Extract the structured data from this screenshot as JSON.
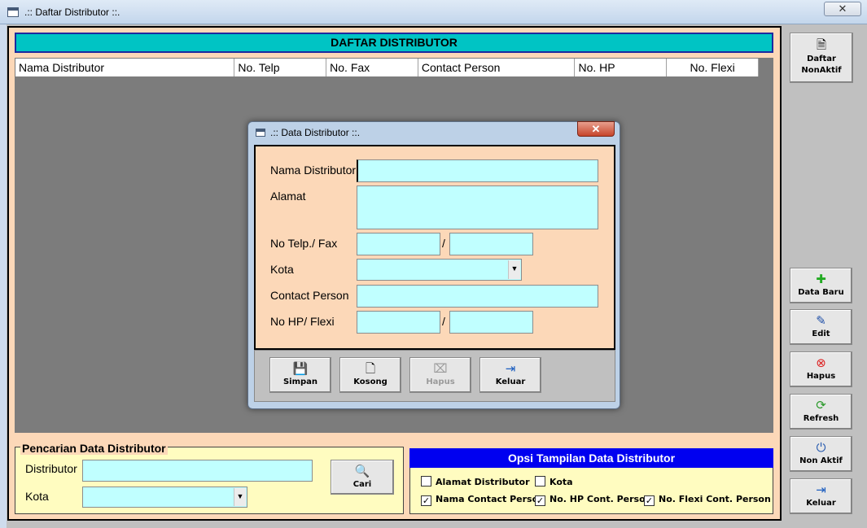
{
  "window": {
    "title": ".:: Daftar Distributor ::.",
    "close_glyph": "✕"
  },
  "list": {
    "title": "DAFTAR DISTRIBUTOR",
    "columns": [
      "Nama Distributor",
      "No. Telp",
      "No. Fax",
      "Contact Person",
      "No. HP",
      "No. Flexi"
    ]
  },
  "search": {
    "legend": "Pencarian Data Distributor",
    "distributor_label": "Distributor",
    "distributor_value": "",
    "kota_label": "Kota",
    "kota_value": "",
    "cari_label": "Cari",
    "cari_icon": "magnifier-icon"
  },
  "options": {
    "title": "Opsi Tampilan Data Distributor",
    "items": [
      {
        "label": "Alamat Distributor",
        "checked": false
      },
      {
        "label": "Kota",
        "checked": false
      },
      {
        "label": "Nama Contact Person",
        "checked": true
      },
      {
        "label": "No. HP Cont. Person",
        "checked": true
      },
      {
        "label": "No. Flexi Cont. Person",
        "checked": true
      }
    ]
  },
  "dialog": {
    "title": ".:: Data Distributor ::.",
    "close_glyph": "✕",
    "fields": {
      "nama_label": "Nama Distributor",
      "alamat_label": "Alamat",
      "telp_label": "No Telp./ Fax",
      "kota_label": "Kota",
      "contact_label": "Contact Person",
      "hp_label": "No HP/ Flexi",
      "separator": "/"
    },
    "buttons": {
      "simpan": "Simpan",
      "kosong": "Kosong",
      "hapus": "Hapus",
      "keluar": "Keluar"
    }
  },
  "toolbar": {
    "daftar_nonaktif": "Daftar NonAktif",
    "data_baru": "Data Baru",
    "edit": "Edit",
    "hapus": "Hapus",
    "refresh": "Refresh",
    "non_aktif": "Non Aktif",
    "keluar": "Keluar"
  },
  "colors": {
    "panel": "#fcd8b8",
    "title_bar": "#00c4c4",
    "grid": "#7c7c7c",
    "input": "#c0ffff",
    "option_header": "#0000f0",
    "group_bg": "#fffcc0"
  }
}
